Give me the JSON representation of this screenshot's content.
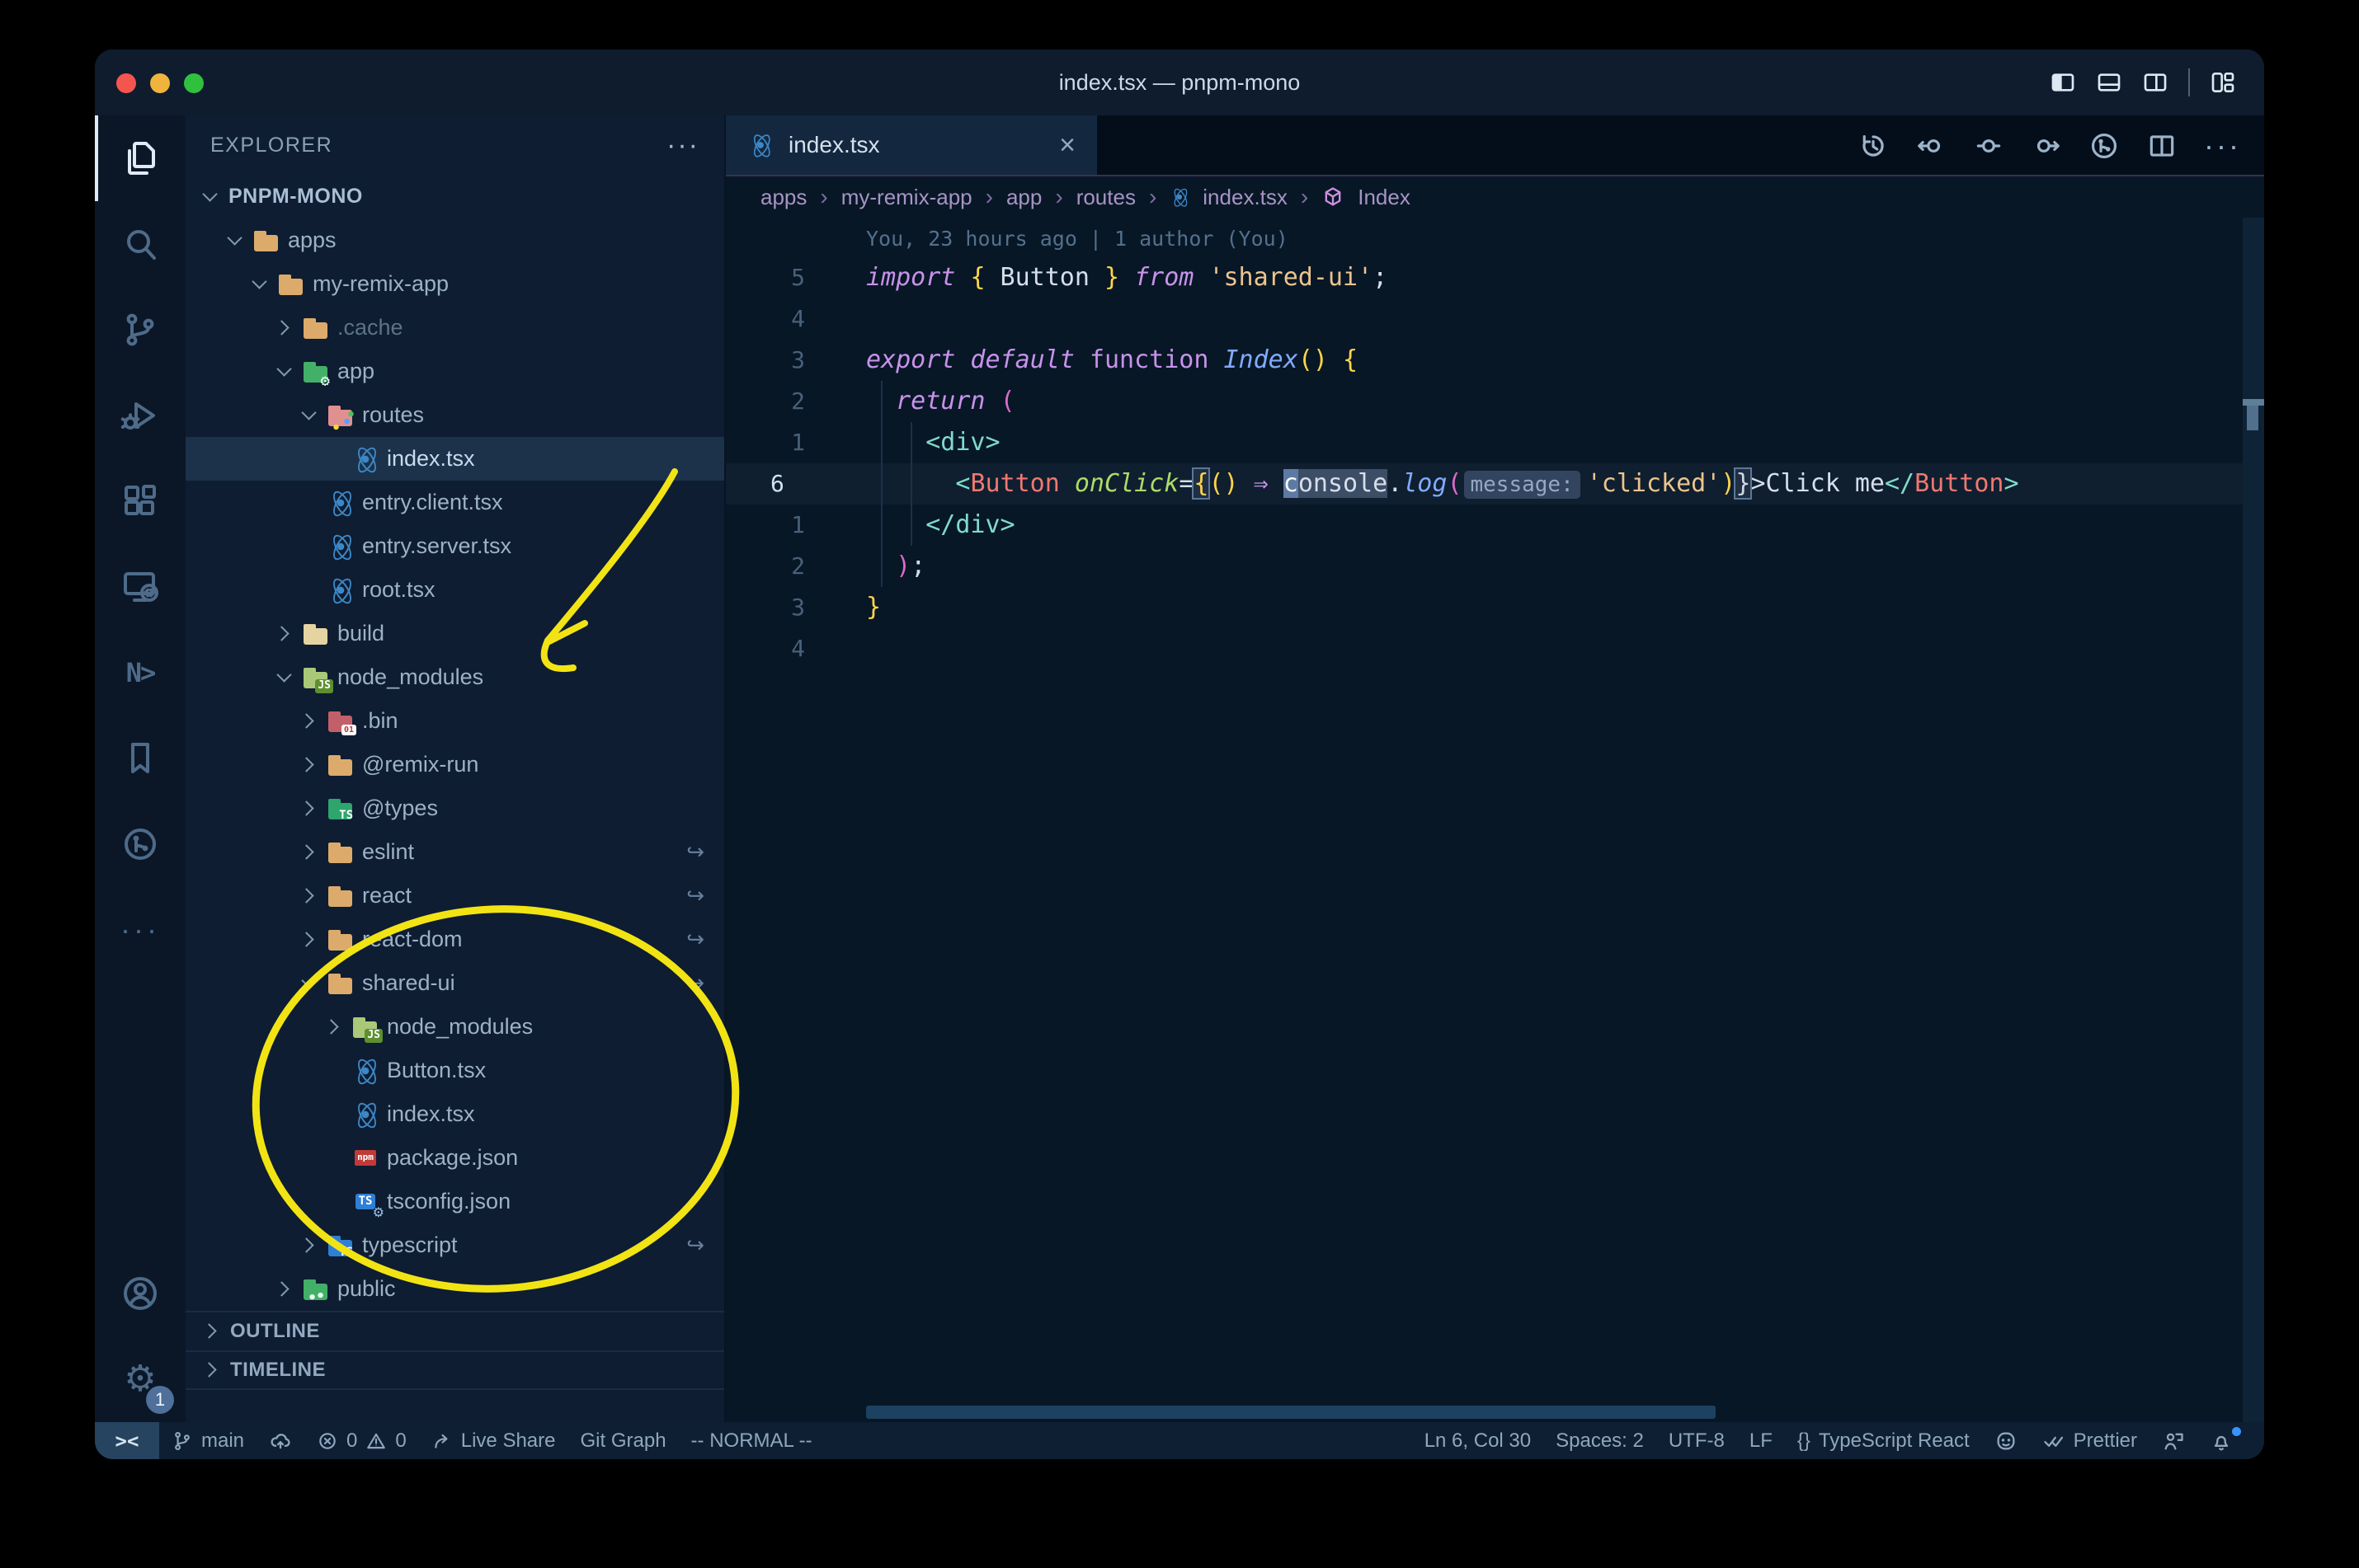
{
  "window": {
    "title": "index.tsx — pnpm-mono"
  },
  "glyphs": {
    "ellipsis": "···",
    "close": "×",
    "sep": "›",
    "remote": "><",
    "nx": "N>",
    "gear": "⚙"
  },
  "activity_bar": {
    "items": [
      "explorer",
      "search",
      "source-control",
      "run-and-debug",
      "extensions",
      "remote-explorer",
      "nx-console",
      "bookmarks",
      "gitlens",
      "additional-views",
      "accounts",
      "manage"
    ],
    "manage_badge": "1"
  },
  "sidebar": {
    "header": "EXPLORER",
    "outline": "OUTLINE",
    "timeline": "TIMELINE",
    "tree": [
      {
        "lvl": 0,
        "chev": "cv",
        "icon": "ic-none",
        "badge": "",
        "label": "PNPM-MONO",
        "cls": "root",
        "link": ""
      },
      {
        "lvl": 1,
        "chev": "cv",
        "icon": "ic-fo fo-tan",
        "badge": "",
        "label": "apps",
        "cls": "",
        "link": ""
      },
      {
        "lvl": 2,
        "chev": "cv",
        "icon": "ic-fo fo-tan",
        "badge": "",
        "label": "my-remix-app",
        "cls": "",
        "link": ""
      },
      {
        "lvl": 3,
        "chev": "cr",
        "icon": "ic-fo fo-tan",
        "badge": "",
        "label": ".cache",
        "cls": "dim",
        "link": ""
      },
      {
        "lvl": 3,
        "chev": "cv",
        "icon": "ic-fo fo-app",
        "badge": "⚙",
        "label": "app",
        "cls": "",
        "link": ""
      },
      {
        "lvl": 4,
        "chev": "cv",
        "icon": "ic-fo fo-routes",
        "badge": "•",
        "label": "routes",
        "cls": "",
        "link": ""
      },
      {
        "lvl": 5,
        "chev": "cn",
        "icon": "ic-react",
        "badge": "",
        "label": "index.tsx",
        "cls": "sel",
        "link": ""
      },
      {
        "lvl": 4,
        "chev": "cn",
        "icon": "ic-react",
        "badge": "",
        "label": "entry.client.tsx",
        "cls": "",
        "link": ""
      },
      {
        "lvl": 4,
        "chev": "cn",
        "icon": "ic-react",
        "badge": "",
        "label": "entry.server.tsx",
        "cls": "",
        "link": ""
      },
      {
        "lvl": 4,
        "chev": "cn",
        "icon": "ic-react",
        "badge": "",
        "label": "root.tsx",
        "cls": "",
        "link": ""
      },
      {
        "lvl": 3,
        "chev": "cr",
        "icon": "ic-fo fo-build",
        "badge": "",
        "label": "build",
        "cls": "",
        "link": ""
      },
      {
        "lvl": 3,
        "chev": "cv",
        "icon": "ic-fo fo-nm",
        "badge": "JS",
        "label": "node_modules",
        "cls": "",
        "link": ""
      },
      {
        "lvl": 4,
        "chev": "cr",
        "icon": "ic-fo fo-bin",
        "badge": "01",
        "label": ".bin",
        "cls": "",
        "link": ""
      },
      {
        "lvl": 4,
        "chev": "cr",
        "icon": "ic-fo fo-tan",
        "badge": "",
        "label": "@remix-run",
        "cls": "",
        "link": ""
      },
      {
        "lvl": 4,
        "chev": "cr",
        "icon": "ic-fo fo-types",
        "badge": "TS",
        "label": "@types",
        "cls": "",
        "link": ""
      },
      {
        "lvl": 4,
        "chev": "cr",
        "icon": "ic-fo fo-tan",
        "badge": "",
        "label": "eslint",
        "cls": "",
        "link": "lk-on"
      },
      {
        "lvl": 4,
        "chev": "cr",
        "icon": "ic-fo fo-tan",
        "badge": "",
        "label": "react",
        "cls": "",
        "link": "lk-on"
      },
      {
        "lvl": 4,
        "chev": "cr",
        "icon": "ic-fo fo-tan",
        "badge": "",
        "label": "react-dom",
        "cls": "",
        "link": "lk-on"
      },
      {
        "lvl": 4,
        "chev": "cv",
        "icon": "ic-fo fo-tan",
        "badge": "",
        "label": "shared-ui",
        "cls": "",
        "link": "lk-on"
      },
      {
        "lvl": 5,
        "chev": "cr",
        "icon": "ic-fo fo-nm",
        "badge": "JS",
        "label": "node_modules",
        "cls": "",
        "link": ""
      },
      {
        "lvl": 5,
        "chev": "cn",
        "icon": "ic-react",
        "badge": "",
        "label": "Button.tsx",
        "cls": "",
        "link": ""
      },
      {
        "lvl": 5,
        "chev": "cn",
        "icon": "ic-react",
        "badge": "",
        "label": "index.tsx",
        "cls": "",
        "link": ""
      },
      {
        "lvl": 5,
        "chev": "cn",
        "icon": "ic-npmbox",
        "badge": "npm",
        "label": "package.json",
        "cls": "",
        "link": ""
      },
      {
        "lvl": 5,
        "chev": "cn",
        "icon": "ic-tsbox",
        "badge": "TS",
        "label": "tsconfig.json",
        "cls": "",
        "link": ""
      },
      {
        "lvl": 4,
        "chev": "cr",
        "icon": "ic-fo fo-ts",
        "badge": "TS",
        "label": "typescript",
        "cls": "",
        "link": "lk-on"
      },
      {
        "lvl": 3,
        "chev": "cr",
        "icon": "ic-fo fo-public",
        "badge": "•",
        "label": "public",
        "cls": "",
        "link": ""
      }
    ]
  },
  "tab": {
    "label": "index.tsx"
  },
  "breadcrumb": {
    "sep": "›",
    "items": [
      "apps",
      "my-remix-app",
      "app",
      "routes"
    ],
    "file": "index.tsx",
    "symbol": "Index"
  },
  "editor": {
    "blame": "You, 23 hours ago | 1 author (You)",
    "lines": [
      {
        "num": "5",
        "cls": "",
        "tokens": [
          [
            "kw",
            "import "
          ],
          [
            "b1",
            "{"
          ],
          [
            "var",
            " Button "
          ],
          [
            "b1",
            "}"
          ],
          [
            "kw",
            " from "
          ],
          [
            "str",
            "'shared-ui'"
          ],
          [
            "p",
            ";"
          ]
        ]
      },
      {
        "num": "4",
        "cls": "",
        "tokens": []
      },
      {
        "num": "3",
        "cls": "",
        "tokens": [
          [
            "kw",
            "export default "
          ],
          [
            "kwu",
            "function "
          ],
          [
            "fn",
            "Index"
          ],
          [
            "b1",
            "()"
          ],
          [
            "p",
            " "
          ],
          [
            "b1",
            "{"
          ]
        ]
      },
      {
        "num": "2",
        "cls": "",
        "tokens": [
          [
            "p",
            "  "
          ],
          [
            "kw",
            "return "
          ],
          [
            "b2",
            "("
          ]
        ]
      },
      {
        "num": "1",
        "cls": "",
        "tokens": [
          [
            "p",
            "    "
          ],
          [
            "tag",
            "<div>"
          ]
        ]
      },
      {
        "num": "6",
        "cls": "active",
        "tokens": [
          [
            "p",
            "      "
          ],
          [
            "tag",
            "<"
          ],
          [
            "cmp",
            "Button"
          ],
          [
            "p",
            " "
          ],
          [
            "attr",
            "onClick"
          ],
          [
            "p",
            "="
          ],
          [
            "bm1",
            "{"
          ],
          [
            "b1",
            "()"
          ],
          [
            "p",
            " "
          ],
          [
            "arr",
            "⇒"
          ],
          [
            "p",
            " "
          ],
          [
            "cur",
            "c"
          ],
          [
            "sel",
            "onsole"
          ],
          [
            "p",
            "."
          ],
          [
            "fn",
            "log"
          ],
          [
            "b2",
            "("
          ],
          [
            "inlay",
            "message:"
          ],
          [
            "str",
            "'clicked'"
          ],
          [
            "b1",
            ")"
          ],
          [
            "bmw",
            "}"
          ],
          [
            "p",
            ">"
          ],
          [
            "txt",
            "Click me"
          ],
          [
            "tag",
            "</"
          ],
          [
            "cmp",
            "Button"
          ],
          [
            "tag",
            ">"
          ]
        ]
      },
      {
        "num": "1",
        "cls": "",
        "tokens": [
          [
            "p",
            "    "
          ],
          [
            "tag",
            "</div>"
          ]
        ]
      },
      {
        "num": "2",
        "cls": "",
        "tokens": [
          [
            "p",
            "  "
          ],
          [
            "b2",
            ")"
          ],
          [
            "p",
            ";"
          ]
        ]
      },
      {
        "num": "3",
        "cls": "",
        "tokens": [
          [
            "b1",
            "}"
          ]
        ]
      },
      {
        "num": "4",
        "cls": "",
        "tokens": []
      }
    ]
  },
  "status_bar": {
    "branch": "main",
    "errors": "0",
    "warnings": "0",
    "live_share": "Live Share",
    "git_graph": "Git Graph",
    "mode": "-- NORMAL --",
    "cursor": "Ln 6, Col 30",
    "indentation": "Spaces: 2",
    "encoding": "UTF-8",
    "eol": "LF",
    "braces": "{}",
    "language": "TypeScript React",
    "prettier": "Prettier"
  },
  "colors": {
    "annotation_yellow": "#f2e414",
    "selection_row": "#1b324a",
    "accent_gold": "#ffd54a",
    "keyword_pink": "#c792ea",
    "string_tan": "#ecc48d",
    "tag_teal": "#7fdbca",
    "editor_bg": "#081726"
  }
}
